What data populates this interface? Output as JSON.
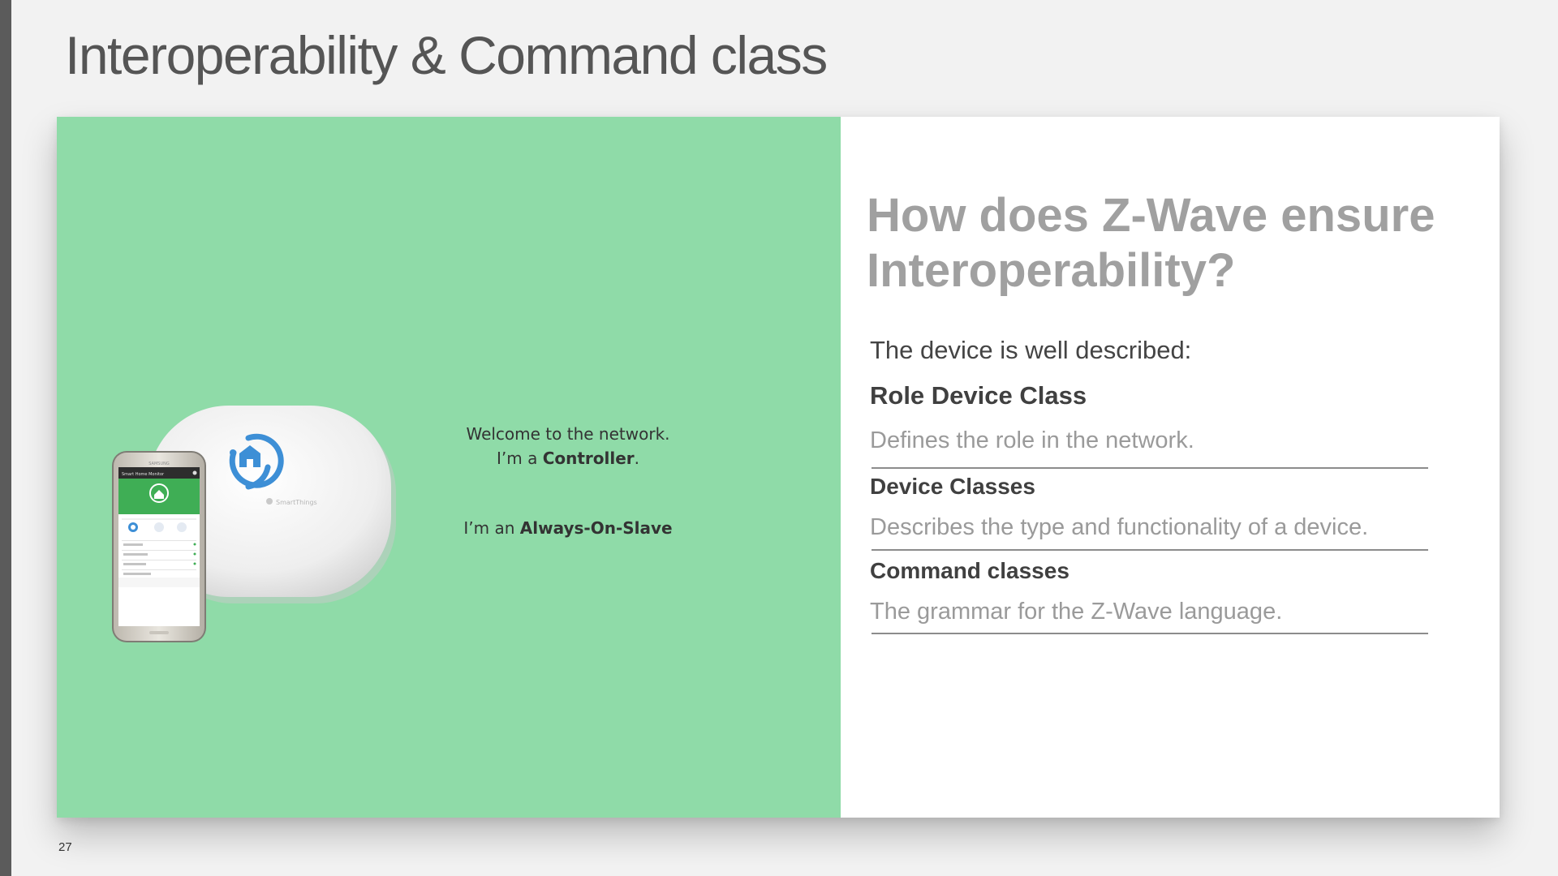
{
  "slide": {
    "title": "Interoperability & Command class",
    "page_number": "27"
  },
  "illustration": {
    "message_to_device": {
      "line1": "Welcome to the network.",
      "line2_prefix": "I’m a ",
      "line2_bold": "Controller",
      "line2_suffix": "."
    },
    "message_to_controller": {
      "prefix": "I’m an ",
      "bold": "Always-On-Slave"
    },
    "hub_brand": "SmartThings",
    "phone_brand": "SAMSUNG",
    "phone_app_title": "Smart Home Monitor",
    "arrow_color": "#3a7fd5",
    "panel_color": "#8fdba8"
  },
  "content": {
    "heading": "How does Z-Wave ensure Interoperability?",
    "intro": "The device is well described:",
    "items": [
      {
        "term": "Role Device Class",
        "description": "Defines the role in the network."
      },
      {
        "term": "Device Classes",
        "description": "Describes the type and functionality of a device."
      },
      {
        "term": "Command classes",
        "description": "The grammar for the Z-Wave language."
      }
    ]
  }
}
